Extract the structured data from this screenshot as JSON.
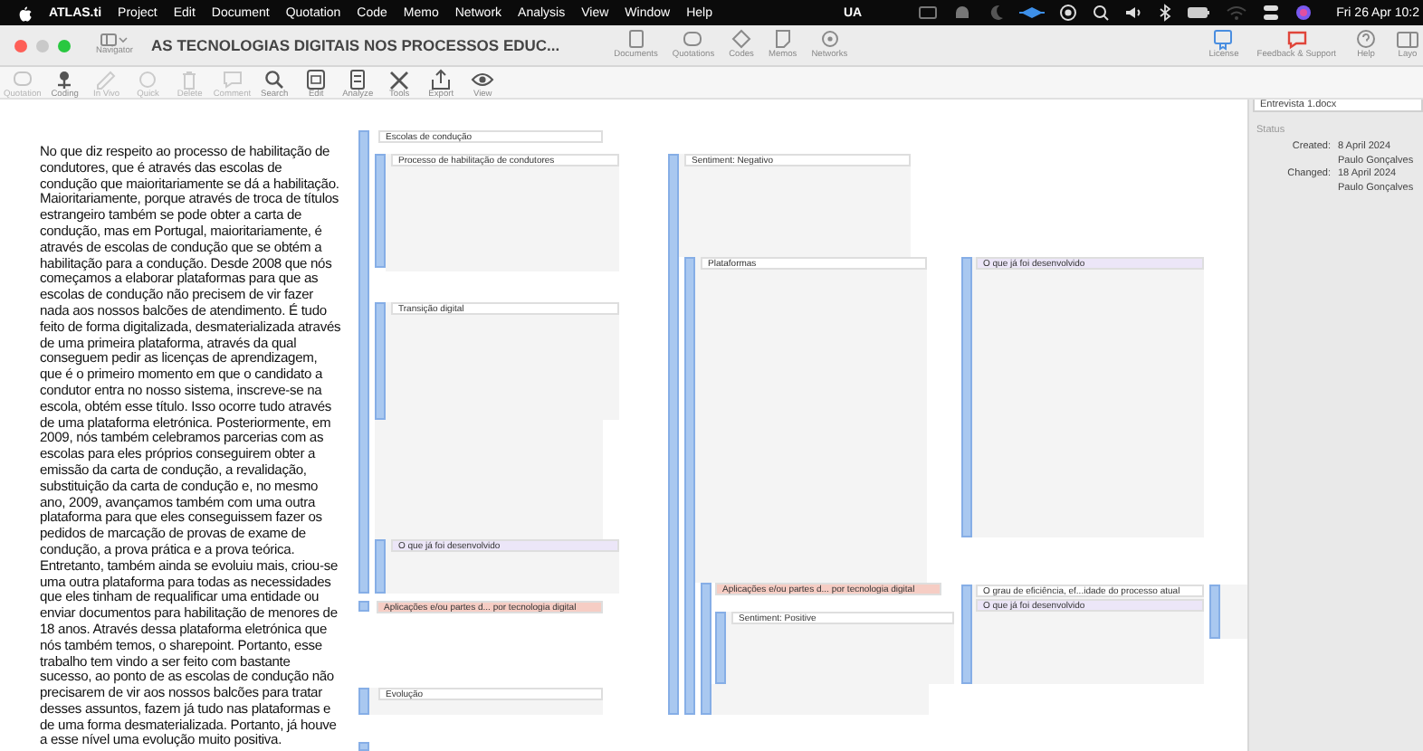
{
  "menubar": {
    "app": "ATLAS.ti",
    "items": [
      "Project",
      "Edit",
      "Document",
      "Quotation",
      "Code",
      "Memo",
      "Network",
      "Analysis",
      "View",
      "Window",
      "Help"
    ],
    "input_source": "UA",
    "clock": "Fri 26 Apr 10:2"
  },
  "titlebar": {
    "navigator": "Navigator",
    "title": "AS TECNOLOGIAS DIGITAIS NOS PROCESSOS EDUC...",
    "buttons": [
      {
        "label": "Documents",
        "kind": "document"
      },
      {
        "label": "Quotations",
        "kind": "quote"
      },
      {
        "label": "Codes",
        "kind": "code"
      },
      {
        "label": "Memos",
        "kind": "memo"
      },
      {
        "label": "Networks",
        "kind": "network"
      }
    ],
    "right_buttons": [
      {
        "label": "License",
        "kind": "license"
      },
      {
        "label": "Feedback & Support",
        "kind": "feedback"
      },
      {
        "label": "Help",
        "kind": "help"
      },
      {
        "label": "Layo",
        "kind": "layout"
      }
    ]
  },
  "toolbar": [
    {
      "label": "Quotation",
      "kind": "quote",
      "disabled": true
    },
    {
      "label": "Coding",
      "kind": "coding",
      "disabled": false
    },
    {
      "label": "In Vivo",
      "kind": "invivo",
      "disabled": true
    },
    {
      "label": "Quick",
      "kind": "quick",
      "disabled": true
    },
    {
      "label": "Delete",
      "kind": "delete",
      "disabled": true
    },
    {
      "label": "Comment",
      "kind": "comment",
      "disabled": true
    },
    {
      "label": "Search",
      "kind": "search",
      "disabled": false
    },
    {
      "label": "Edit",
      "kind": "edit",
      "disabled": false
    },
    {
      "label": "Analyze",
      "kind": "analyze",
      "disabled": false
    },
    {
      "label": "Tools",
      "kind": "tools",
      "disabled": false
    },
    {
      "label": "Export",
      "kind": "export",
      "disabled": false
    },
    {
      "label": "View",
      "kind": "view",
      "disabled": false
    }
  ],
  "document": {
    "text": "No que diz respeito ao processo de habilitação de condutores, que é através das escolas de condução que maioritariamente se dá a habilitação. Maioritariamente, porque através de troca de títulos estrangeiro também se pode obter a carta de condução, mas em Portugal, maioritariamente, é através de escolas de condução que se obtém a habilitação para a condução. Desde 2008 que nós começamos a elaborar plataformas para que as escolas de condução não precisem de vir fazer nada aos nossos balcões de atendimento. É tudo feito de forma digitalizada, desmaterializada através de uma primeira plataforma, através da qual conseguem pedir as licenças de aprendizagem, que é o primeiro momento em que o candidato a condutor entra no nosso sistema, inscreve-se na escola, obtém esse título. Isso ocorre tudo através de uma plataforma eletrónica. Posteriormente, em 2009, nós também celebramos parcerias com as escolas para eles próprios conseguirem obter a emissão da carta de condução, a revalidação, substituição da carta de condução e, no mesmo ano, 2009, avançamos também com uma outra plataforma para que eles conseguissem fazer os pedidos de marcação de provas de exame de condução, a prova prática e a prova teórica. Entretanto, também ainda se evoluiu mais, criou-se uma outra plataforma para todas as necessidades que eles tinham de requalificar uma entidade ou enviar documentos para habilitação de menores de 18 anos. Através dessa plataforma eletrónica que nós também temos, o sharepoint. Portanto, esse trabalho tem vindo a ser feito com bastante sucesso, ao ponto de as escolas de condução não precisarem de vir aos nossos balcões para tratar desses assuntos, fazem já tudo nas plataformas e de uma forma desmaterializada. Portanto, já houve a esse nível uma evolução muito positiva."
  },
  "margin_codes": [
    {
      "label": "Escolas de condução",
      "color": "#ffffff"
    },
    {
      "label": "Processo de habilitação de condutores",
      "color": "#ffffff"
    },
    {
      "label": "Sentiment: Negativo",
      "color": "#ffffff"
    },
    {
      "label": "Plataformas",
      "color": "#ffffff"
    },
    {
      "label": "O que já foi desenvolvido",
      "color": "#ece6f8"
    },
    {
      "label": "Transição digital",
      "color": "#ffffff"
    },
    {
      "label": "O que já foi desenvolvido",
      "color": "#ece6f8"
    },
    {
      "label": "Aplicações e/ou partes d... por tecnologia digital",
      "color": "#f6cdc4"
    },
    {
      "label": "O grau de eficiência, ef...idade do processo atual",
      "color": "#ffffff"
    },
    {
      "label": "Aplicações e/ou partes d... por tecnologia digital",
      "color": "#f6cdc4"
    },
    {
      "label": "O que já foi desenvolvido",
      "color": "#ece6f8"
    },
    {
      "label": "Sentiment: Positive",
      "color": "#ffffff"
    },
    {
      "label": "Evolução",
      "color": "#ffffff"
    }
  ],
  "inspector": {
    "document": "Entrevista 1.docx",
    "heading": "Status",
    "fields": [
      {
        "label": "Created:",
        "value": "8 April 2024"
      },
      {
        "value": "Paulo  Gonçalves"
      },
      {
        "label": "Changed:",
        "value": "18 April 2024"
      },
      {
        "value": "Paulo  Gonçalves"
      }
    ]
  }
}
